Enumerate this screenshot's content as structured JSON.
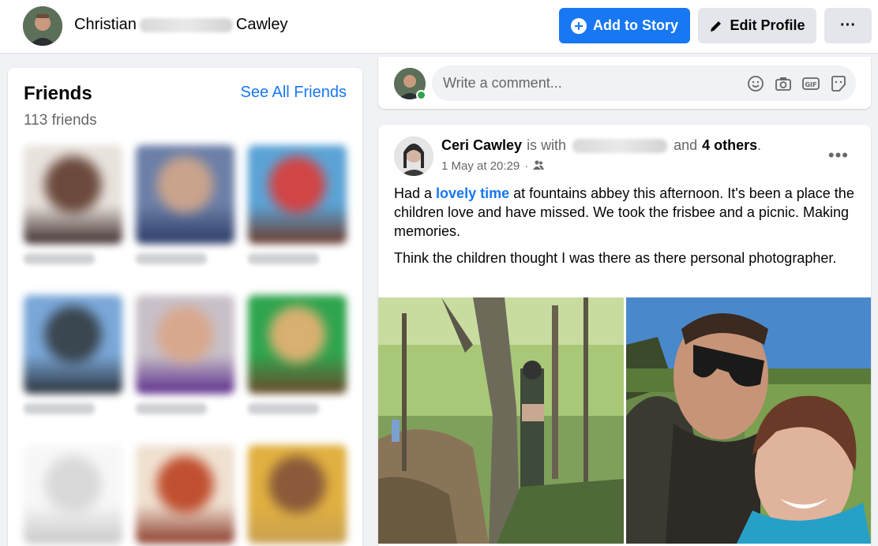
{
  "profile": {
    "first_name": "Christian",
    "last_name": "Cawley"
  },
  "actions": {
    "add_story": "Add to Story",
    "edit_profile": "Edit Profile",
    "more": "···"
  },
  "friends": {
    "title": "Friends",
    "see_all": "See All Friends",
    "count": "113 friends",
    "tiles": [
      {
        "colors": [
          "#e8e2dc",
          "#6b4a3d",
          "#3b2a2a"
        ]
      },
      {
        "colors": [
          "#6b7fa8",
          "#c9a38c",
          "#2a3a66"
        ]
      },
      {
        "colors": [
          "#5ba3d6",
          "#d14545",
          "#6b3a2a"
        ]
      },
      {
        "colors": [
          "#7aa7d8",
          "#3a4650",
          "#2a3038"
        ]
      },
      {
        "colors": [
          "#c8c0c8",
          "#d8a88e",
          "#5a2a8a"
        ]
      },
      {
        "colors": [
          "#2fa44e",
          "#d8b070",
          "#6b4a2a"
        ]
      },
      {
        "colors": [
          "#f7f7f7",
          "#d9d9d9",
          "#c8c8c8"
        ]
      },
      {
        "colors": [
          "#f0e0d0",
          "#c05030",
          "#8a3a2a"
        ]
      },
      {
        "colors": [
          "#e0b040",
          "#8a5a3a",
          "#c8a050"
        ]
      }
    ]
  },
  "comment": {
    "placeholder": "Write a comment..."
  },
  "post": {
    "author": "Ceri Cawley",
    "with_text": "is with",
    "and_text": "and",
    "others": "4 others",
    "period": ".",
    "timestamp": "1 May at 20:29",
    "more": "•••",
    "para1_before": "Had a ",
    "para1_link": "lovely time",
    "para1_after": " at fountains abbey this afternoon. It's been a place the children love and have missed. We took the frisbee and a picnic. Making memories.",
    "para2": "Think the children thought I was there as there personal photographer."
  },
  "colors": {
    "accent": "#1877f2",
    "online": "#31a24c",
    "secondary_text": "#65676b"
  }
}
